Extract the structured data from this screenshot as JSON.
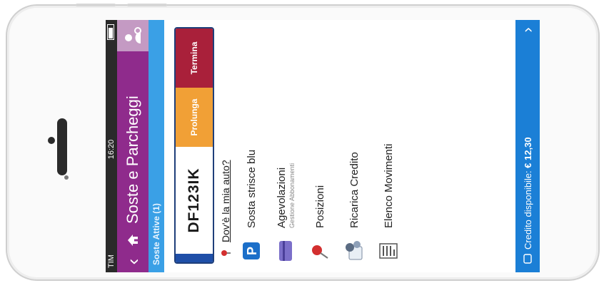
{
  "status": {
    "carrier": "TIM",
    "time": "16:20"
  },
  "header": {
    "title": "Soste e Parcheggi"
  },
  "subheader": {
    "label": "Soste Attive (1)"
  },
  "ticket": {
    "plate": "DF123IK",
    "prolunga": "Prolunga",
    "termina": "Termina"
  },
  "where_link": "Dov'è la mia auto?",
  "menu": [
    {
      "label": "Sosta strisce blu",
      "icon": "parking-icon"
    },
    {
      "label": "Agevolazioni",
      "sub": "Gestione Abbonamenti",
      "icon": "card-icon"
    },
    {
      "label": "Posizioni",
      "icon": "pin-icon"
    },
    {
      "label": "Ricarica Credito",
      "icon": "coins-icon"
    },
    {
      "label": "Elenco Movimenti",
      "icon": "list-icon"
    }
  ],
  "footer": {
    "label": "Credito disponibile: ",
    "amount": "€ 12,30"
  },
  "colors": {
    "header": "#8f2b8c",
    "subheader": "#3aa0e6",
    "prolunga": "#f1a036",
    "termina": "#a9203a",
    "footer": "#1b7fd6"
  }
}
